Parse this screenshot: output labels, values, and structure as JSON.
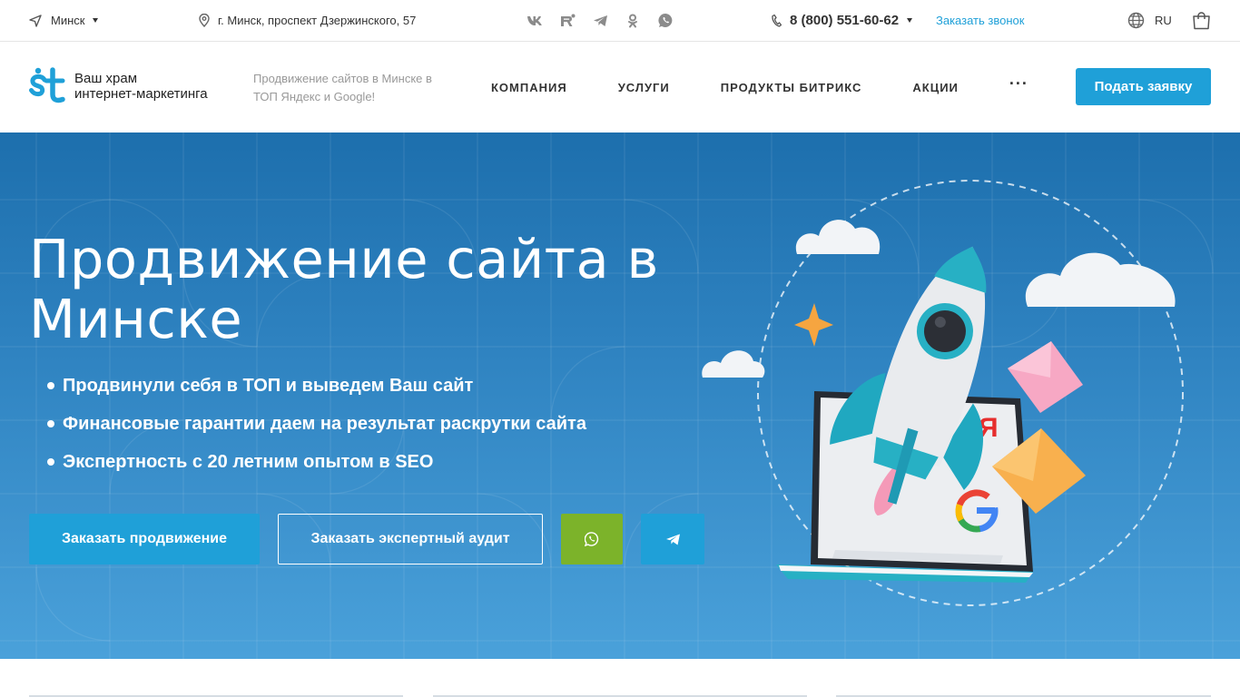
{
  "topbar": {
    "city": "Минск",
    "address": "г. Минск, проспект Дзержинского, 57",
    "social": [
      {
        "name": "vk-icon",
        "glyph": "vk"
      },
      {
        "name": "rutube-icon",
        "glyph": "R"
      },
      {
        "name": "telegram-icon",
        "glyph": ""
      },
      {
        "name": "odnoklassniki-icon",
        "glyph": ""
      },
      {
        "name": "whatsapp-icon",
        "glyph": ""
      }
    ],
    "phone": "8 (800) 551-60-62",
    "callback": "Заказать звонок",
    "lang": "RU"
  },
  "header": {
    "logo_line1": "Ваш храм",
    "logo_line2": "интернет-маркетинга",
    "slogan": "Продвижение сайтов в Минске в ТОП Яндекс и Google!",
    "nav": [
      "КОМПАНИЯ",
      "УСЛУГИ",
      "ПРОДУКТЫ БИТРИКС",
      "АКЦИИ"
    ],
    "more": "···",
    "apply_button": "Подать заявку"
  },
  "hero": {
    "title": "Продвижение сайта в Минске",
    "bullets": [
      "Продвинули себя в ТОП и выведем Ваш сайт",
      "Финансовые гарантии даем на результат раскрутки сайта",
      "Экспертность с 20 летним опытом в SEO"
    ],
    "btn_promo": "Заказать продвижение",
    "btn_audit": "Заказать экспертный аудит",
    "illustration_letters": {
      "yandex": "Я",
      "google": "G"
    }
  },
  "colors": {
    "accent": "#1fa0d8",
    "whatsapp": "#7cb32a",
    "hero_top": "#1d6fad",
    "hero_bottom": "#4aa1da"
  }
}
